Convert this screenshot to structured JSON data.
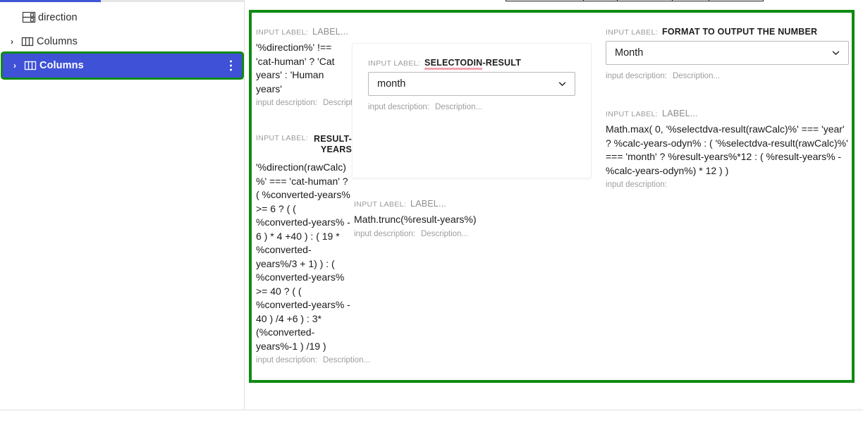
{
  "sidebar": {
    "items": [
      {
        "label": "direction",
        "icon": "rows-icon",
        "has_chevron": false,
        "selected": false
      },
      {
        "label": "Columns",
        "icon": "columns-icon",
        "has_chevron": true,
        "selected": false
      },
      {
        "label": "Columns",
        "icon": "columns-icon",
        "has_chevron": true,
        "selected": true,
        "menu_icon": "kebab-icon"
      }
    ],
    "chevron_glyph": "›"
  },
  "toolbar": {
    "segments": [
      110,
      48,
      78,
      52,
      78
    ]
  },
  "colors": {
    "selection_blue": "#3f51d6",
    "highlight_green": "#0f8a12",
    "accent_tab": "#4055d8",
    "spellcheck_underline": "#f3a3b0"
  },
  "fields": {
    "direction_label": {
      "label_key": "INPUT LABEL:",
      "label_value": "LABEL...",
      "expression": "'%direction%' !== 'cat-human' ? 'Cat years' : 'Human years'",
      "description_key": "input description:",
      "description_value": "Description..."
    },
    "result_years": {
      "label_key": "INPUT LABEL:",
      "label_value": "RESULT-YEARS",
      "expression": "'%direction(rawCalc)%' === 'cat-human' ? ( %converted-years% >= 6 ? ( ( %converted-years% - 6 ) * 4 +40 ) : ( 19 * %converted-years%/3 + 1) ) : ( %converted-years% >= 40 ? ( ( %converted-years% - 40 ) /4 +6 ) : 3* (%converted-years%-1 ) /19 )",
      "description_key": "input description:",
      "description_value": "Description..."
    },
    "selectodin_result": {
      "label_key": "INPUT LABEL:",
      "label_value_misspelled": "SELECTODIN",
      "label_value_rest": "-RESULT",
      "select_value": "month",
      "select_icon": "chevron-down-icon",
      "description_key": "input description:",
      "description_value": "Description..."
    },
    "math_trunc": {
      "label_key": "INPUT LABEL:",
      "label_value": "LABEL...",
      "expression": "Math.trunc(%result-years%)",
      "description_key": "input description:",
      "description_value": "Description..."
    },
    "format_output": {
      "label_key": "INPUT LABEL:",
      "label_value": "FORMAT TO OUTPUT THE NUMBER",
      "select_value": "Month",
      "select_icon": "chevron-down-icon",
      "description_key": "input description:",
      "description_value": "Description..."
    },
    "math_max": {
      "label_key": "INPUT LABEL:",
      "label_value": "LABEL...",
      "expression": "Math.max( 0, '%selectdva-result(rawCalc)%' === 'year' ? %calc-years-odyn% : ( '%selectdva-result(rawCalc)%' === 'month' ? %result-years%*12 : ( %result-years% - %calc-years-odyn%) * 12 ) )",
      "description_key": "input description:",
      "description_value": ""
    }
  }
}
